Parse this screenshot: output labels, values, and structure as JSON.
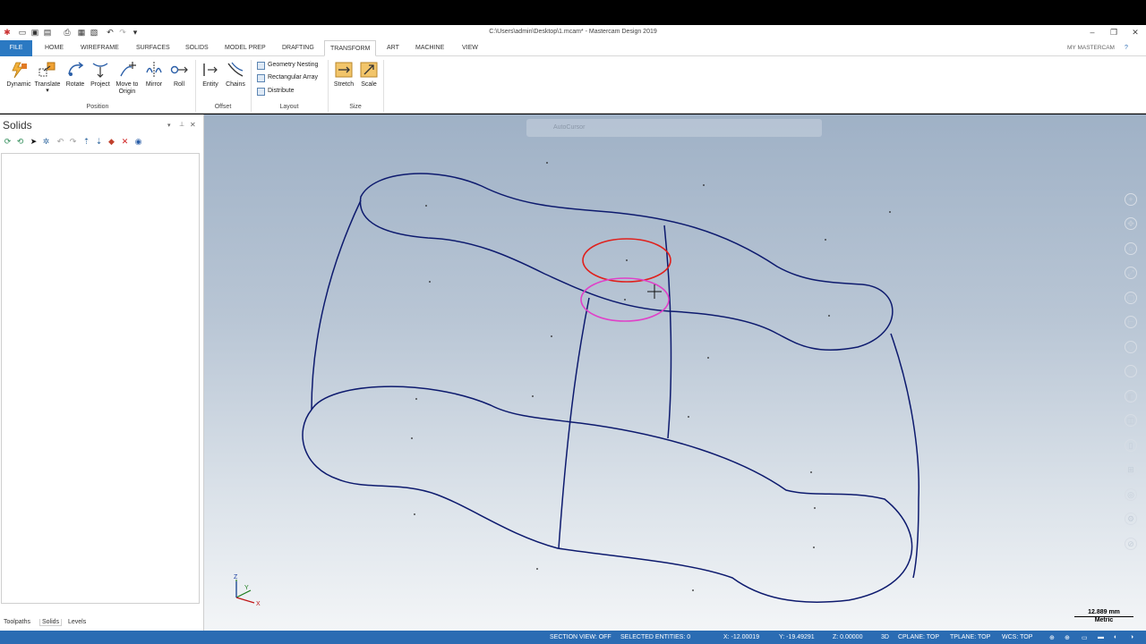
{
  "window": {
    "title": "C:\\Users\\admin\\Desktop\\1.mcam* - Mastercam Design 2019",
    "controls": [
      "–",
      "❐",
      "✕"
    ]
  },
  "tabs": [
    "FILE",
    "HOME",
    "WIREFRAME",
    "SURFACES",
    "SOLIDS",
    "MODEL PREP",
    "DRAFTING",
    "TRANSFORM",
    "ART",
    "MACHINE",
    "VIEW"
  ],
  "active_tab": "TRANSFORM",
  "account": {
    "label": "MY MASTERCAM"
  },
  "ribbon": {
    "position": {
      "group_label": "Position",
      "buttons": [
        "Dynamic",
        "Translate",
        "Rotate",
        "Project",
        "Move to",
        "Origin",
        "Mirror",
        "Roll"
      ]
    },
    "offset": {
      "group_label": "Offset",
      "buttons": [
        "Entity",
        "Chains"
      ]
    },
    "layout": {
      "group_label": "Layout",
      "items": [
        "Geometry Nesting",
        "Rectangular Array",
        "Distribute"
      ]
    },
    "size": {
      "group_label": "Size",
      "buttons": [
        "Stretch",
        "Scale"
      ]
    }
  },
  "left_panel": {
    "title": "Solids",
    "bottom_tabs": [
      "Toolpaths",
      "Solids",
      "Levels"
    ],
    "active_tab": "Solids"
  },
  "viewport": {
    "autocursor_label": "AutoCursor",
    "axis_labels": {
      "z": "Z",
      "y": "Y",
      "x": "X"
    },
    "scale": {
      "value": "12.889 mm",
      "unit": "Metric"
    }
  },
  "status": {
    "section_view": "SECTION VIEW: OFF",
    "selected": "SELECTED ENTITIES: 0",
    "x": "X:  -12.00019",
    "y": "Y:  -19.49291",
    "z": "Z:  0.00000",
    "mode": "3D",
    "cplane": "CPLANE: TOP",
    "tplane": "TPLANE: TOP",
    "wcs": "WCS: TOP"
  },
  "colors": {
    "wire": "#0d1a6e",
    "circle_selected": "#e0201c",
    "circle_hover": "#e040c8",
    "accent": "#2b6cb3"
  }
}
